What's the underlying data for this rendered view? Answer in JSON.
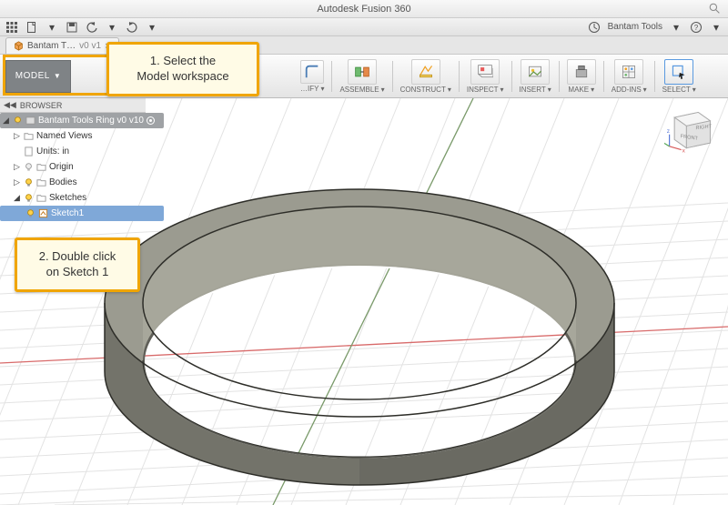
{
  "title": "Autodesk Fusion 360",
  "qa": {
    "right_label": "Bantam Tools"
  },
  "tabs": {
    "active": "Bantam T…",
    "ver": "v0 v1"
  },
  "workspace": {
    "label": "MODEL"
  },
  "toolbar": {
    "modify_label": "…IFY",
    "assemble_label": "ASSEMBLE",
    "construct_label": "CONSTRUCT",
    "inspect_label": "INSPECT",
    "insert_label": "INSERT",
    "make_label": "MAKE",
    "addins_label": "ADD-INS",
    "select_label": "SELECT"
  },
  "browser": {
    "title": "BROWSER",
    "root": "Bantam Tools Ring v0 v10",
    "named_views": "Named Views",
    "units": "Units: in",
    "origin": "Origin",
    "bodies": "Bodies",
    "sketches": "Sketches",
    "sketch1": "Sketch1"
  },
  "callout1": {
    "line1": "1. Select the",
    "line2": "Model workspace"
  },
  "callout2": {
    "line1": "2. Double click",
    "line2": "on Sketch 1"
  },
  "viewcube": {
    "front": "FRONT",
    "right": "RIGHT"
  }
}
